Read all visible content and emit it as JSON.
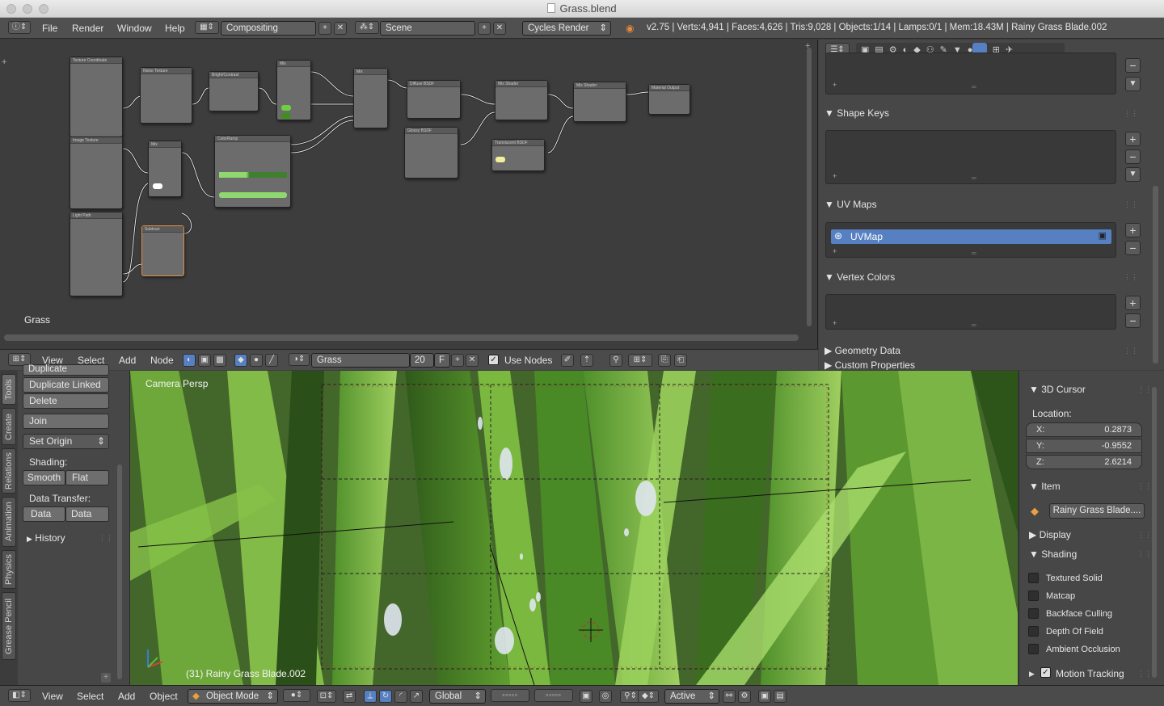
{
  "window": {
    "title": "Grass.blend"
  },
  "topbar": {
    "menus": [
      "File",
      "Render",
      "Window",
      "Help"
    ],
    "screen_layout": "Compositing",
    "scene": "Scene",
    "render_engine": "Cycles Render",
    "stats": "v2.75 | Verts:4,941 | Faces:4,626 | Tris:9,028 | Objects:1/14 | Lamps:0/1 | Mem:18.43M | Rainy Grass Blade.002"
  },
  "node_editor": {
    "material_label": "Grass",
    "nodes": [
      "Texture Coordinate",
      "Noise Texture",
      "Bright/Contrast",
      "Mix",
      "Mix",
      "Diffuse BSDF",
      "Mix Shader",
      "Mix Shader",
      "Material Output",
      "Image Texture",
      "Mix",
      "ColorRamp",
      "Glossy BSDF",
      "Translucent BSDF",
      "Light Path",
      "Subtract"
    ]
  },
  "node_header": {
    "menus": [
      "View",
      "Select",
      "Add",
      "Node"
    ],
    "material_name": "Grass",
    "users": "20",
    "fake_user": "F",
    "use_nodes_label": "Use Nodes",
    "use_nodes_checked": true
  },
  "properties": {
    "shape_keys": "Shape Keys",
    "uv_maps": "UV Maps",
    "uv_map_item": "UVMap",
    "vertex_colors": "Vertex Colors",
    "geometry_data": "Geometry Data",
    "custom_properties": "Custom Properties"
  },
  "toolshelf": {
    "tabs": [
      "Tools",
      "Create",
      "Relations",
      "Animation",
      "Physics",
      "Grease Pencil"
    ],
    "duplicate": "Duplicate",
    "duplicate_linked": "Duplicate Linked",
    "delete": "Delete",
    "join": "Join",
    "set_origin": "Set Origin",
    "shading_label": "Shading:",
    "smooth": "Smooth",
    "flat": "Flat",
    "data_transfer_label": "Data Transfer:",
    "data": "Data",
    "data_lay": "Data Lay",
    "history": "History"
  },
  "viewport": {
    "view_label": "Camera Persp",
    "object_label": "(31) Rainy Grass Blade.002"
  },
  "npanel": {
    "cursor_header": "3D Cursor",
    "location_label": "Location:",
    "x_label": "X:",
    "x_value": "0.2873",
    "y_label": "Y:",
    "y_value": "-0.9552",
    "z_label": "Z:",
    "z_value": "2.6214",
    "item_header": "Item",
    "item_name": "Rainy Grass Blade....",
    "display_header": "Display",
    "shading_header": "Shading",
    "textured_solid": "Textured Solid",
    "matcap": "Matcap",
    "backface_culling": "Backface Culling",
    "depth_of_field": "Depth Of Field",
    "ambient_occlusion": "Ambient Occlusion",
    "motion_tracking": "Motion Tracking",
    "motion_tracking_checked": true
  },
  "bottombar": {
    "menus": [
      "View",
      "Select",
      "Add",
      "Object"
    ],
    "mode": "Object Mode",
    "orientation": "Global",
    "pivot": "Active"
  },
  "colors": {
    "uv_selected": "#5680c2",
    "grass_dark": "#2f5a1a",
    "grass_light": "#7fbf3f"
  }
}
